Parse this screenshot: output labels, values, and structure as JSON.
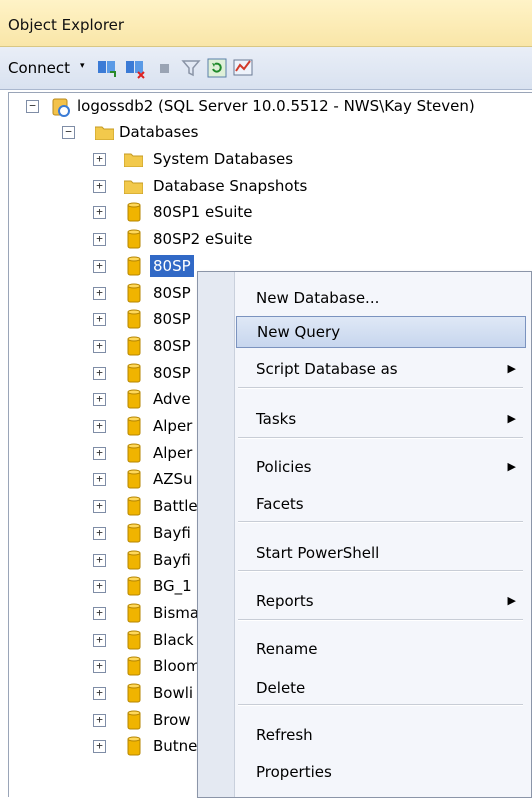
{
  "window": {
    "title": "Object Explorer"
  },
  "toolbar": {
    "connect_label": "Connect",
    "connect_caret": "▾"
  },
  "tree": {
    "server_label": "logossdb2 (SQL Server 10.0.5512 - NWS\\Kay Steven)",
    "databases_label": "Databases",
    "items": [
      {
        "label": "System Databases",
        "icon": "folder-icon"
      },
      {
        "label": "Database Snapshots",
        "icon": "folder-icon"
      },
      {
        "label": "80SP1 eSuite",
        "icon": "database-icon"
      },
      {
        "label": "80SP2 eSuite",
        "icon": "database-icon"
      },
      {
        "label": "80SP",
        "icon": "database-icon",
        "selected": true
      },
      {
        "label": "80SP",
        "icon": "database-icon"
      },
      {
        "label": "80SP",
        "icon": "database-icon"
      },
      {
        "label": "80SP",
        "icon": "database-icon"
      },
      {
        "label": "80SP",
        "icon": "database-icon"
      },
      {
        "label": "Adve",
        "icon": "database-icon"
      },
      {
        "label": "Alper",
        "icon": "database-icon"
      },
      {
        "label": "Alper",
        "icon": "database-icon"
      },
      {
        "label": "AZSu",
        "icon": "database-icon"
      },
      {
        "label": "Battle",
        "icon": "database-icon"
      },
      {
        "label": "Bayfi",
        "icon": "database-icon"
      },
      {
        "label": "Bayfi",
        "icon": "database-icon"
      },
      {
        "label": "BG_1",
        "icon": "database-icon"
      },
      {
        "label": "Bisma",
        "icon": "database-icon"
      },
      {
        "label": "Black",
        "icon": "database-icon"
      },
      {
        "label": "Bloom",
        "icon": "database-icon"
      },
      {
        "label": "Bowli",
        "icon": "database-icon"
      },
      {
        "label": "Brow",
        "icon": "database-icon"
      },
      {
        "label": "Butne",
        "icon": "database-icon"
      }
    ]
  },
  "context_menu": {
    "items": [
      {
        "label": "New Database...",
        "submenu": false
      },
      {
        "label": "New Query",
        "submenu": false,
        "highlighted": true
      },
      {
        "label": "Script Database as",
        "submenu": true
      },
      {
        "label": "Tasks",
        "submenu": true
      },
      {
        "label": "Policies",
        "submenu": true
      },
      {
        "label": "Facets",
        "submenu": false
      },
      {
        "label": "Start PowerShell",
        "submenu": false
      },
      {
        "label": "Reports",
        "submenu": true
      },
      {
        "label": "Rename",
        "submenu": false
      },
      {
        "label": "Delete",
        "submenu": false
      },
      {
        "label": "Refresh",
        "submenu": false
      },
      {
        "label": "Properties",
        "submenu": false
      }
    ],
    "submenu_arrow": "▶"
  },
  "colors": {
    "selection": "#3169c6",
    "db_icon": "#f0b400",
    "folder_icon": "#f2c94c"
  }
}
